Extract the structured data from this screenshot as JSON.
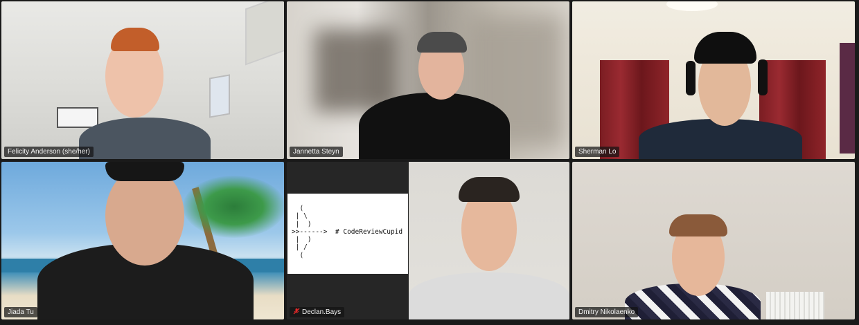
{
  "meeting": {
    "participants": [
      {
        "name": "Felicity Anderson (she/her)",
        "muted": false,
        "active_speaker": false
      },
      {
        "name": "Jannetta Steyn",
        "muted": false,
        "active_speaker": false
      },
      {
        "name": "Sherman Lo",
        "muted": false,
        "active_speaker": true
      },
      {
        "name": "Jiada Tu",
        "muted": false,
        "active_speaker": false
      },
      {
        "name": "Declan.Bays",
        "muted": true,
        "active_speaker": false
      },
      {
        "name": "Dmitry Nikolaenko",
        "muted": false,
        "active_speaker": false
      }
    ],
    "shared_card": {
      "ascii_art": "  (\n | \\\n |  )\n>>------>  # CodeReviewCupid\n |  )\n | /\n  ("
    },
    "colors": {
      "active_speaker_border": "#23d160",
      "mute_icon": "#e02828",
      "background": "#1a1a1a"
    },
    "icons": {
      "muted": "microphone-muted-icon"
    }
  }
}
